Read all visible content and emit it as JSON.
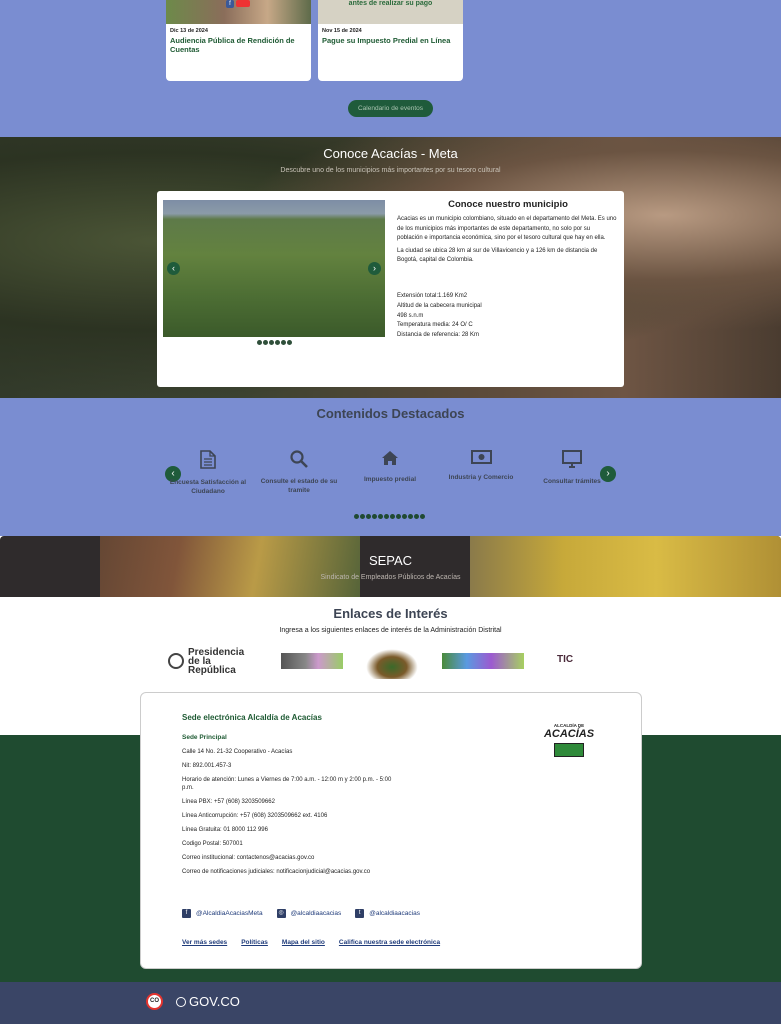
{
  "events": {
    "cards": [
      {
        "date": "Dic 13 de 2024",
        "title": "Audiencia Pública de Rendición de Cuentas"
      },
      {
        "date": "Nov 15 de 2024",
        "title": "Pague su Impuesto Predial en Línea",
        "banner": "antes de realizar su pago"
      }
    ],
    "calendar_button": "Calendario de eventos"
  },
  "conoce": {
    "title": "Conoce Acacías - Meta",
    "subtitle": "Descubre uno de los municipios más importantes por su tesoro cultural",
    "card_title": "Conoce nuestro municipio",
    "paragraphs": [
      "Acacias es un municipio colombiano, situado en el departamento del Meta. Es uno de los municipios más importantes de este departamento, no solo por su población e importancia económica, sino por el tesoro cultural que hay en ella.",
      "La ciudad se ubica 28 km al sur de Villavicencio y a 126 km de distancia de Bogotá, capital de Colombia."
    ],
    "facts": [
      "Extensión total:1.169 Km2",
      "Altitud de la cabecera municipal",
      "498 s.n.m",
      "Temperatura media: 24 O/ C",
      "Distancia de referencia: 28 Km"
    ]
  },
  "contenidos": {
    "title": "Contenidos Destacados",
    "items": [
      {
        "label": "Encuesta Satisfacción al Ciudadano",
        "icon": "document-icon"
      },
      {
        "label": "Consulte el estado de su tramite",
        "icon": "search-icon"
      },
      {
        "label": "Impuesto predial",
        "icon": "home-icon"
      },
      {
        "label": "Industria y Comercio",
        "icon": "money-icon"
      },
      {
        "label": "Consultar trámites",
        "icon": "monitor-icon"
      }
    ]
  },
  "sepac": {
    "title": "SEPAC",
    "subtitle": "Sindicato de Empleados Públicos de Acacías"
  },
  "enlaces": {
    "title": "Enlaces de Interés",
    "subtitle": "Ingresa a los siguientes enlaces de interés de la Administración Distrital",
    "logos": {
      "presidencia": "Presidencia de la República",
      "mintic": "TIC"
    }
  },
  "footer": {
    "title": "Sede electrónica Alcaldía de Acacías",
    "sede_label": "Sede Principal",
    "address": "Calle 14 No. 21-32 Cooperativo - Acacías",
    "nit": "Nit: 892.001.457-3",
    "horario": "Horario de atención: Lunes a Viernes de 7:00 a.m. - 12:00 m y 2:00 p.m. - 5:00 p.m.",
    "pbx": "Línea PBX: +57 (608) 3203509662",
    "anticorrupcion": "Línea Anticorrupción: +57 (608)  3203509662 ext. 4106",
    "gratuita": "Línea Gratuita: 01 8000 112 996",
    "postal": "Codigo Postal: 507001",
    "correo": "Correo institucional: contactenos@acacias.gov.co",
    "notificaciones": "Correo de notificaciones judiciales: notificacionjudicial@acacias.gov.co",
    "logo_name": "ACACÍAS",
    "logo_small": "ALCALDÍA DE",
    "socials": [
      {
        "icon": "facebook-icon",
        "label": "@AlcaldiaAcaciasMeta"
      },
      {
        "icon": "instagram-icon",
        "label": "@alcaldiaacacias"
      },
      {
        "icon": "twitter-icon",
        "label": "@alcaldiaacacias"
      }
    ],
    "links": [
      "Ver más sedes",
      "Políticas",
      "Mapa del sitio",
      "Califica nuestra sede electrónica"
    ]
  },
  "govbar": {
    "badge": "CO",
    "label": "GOV.CO"
  }
}
